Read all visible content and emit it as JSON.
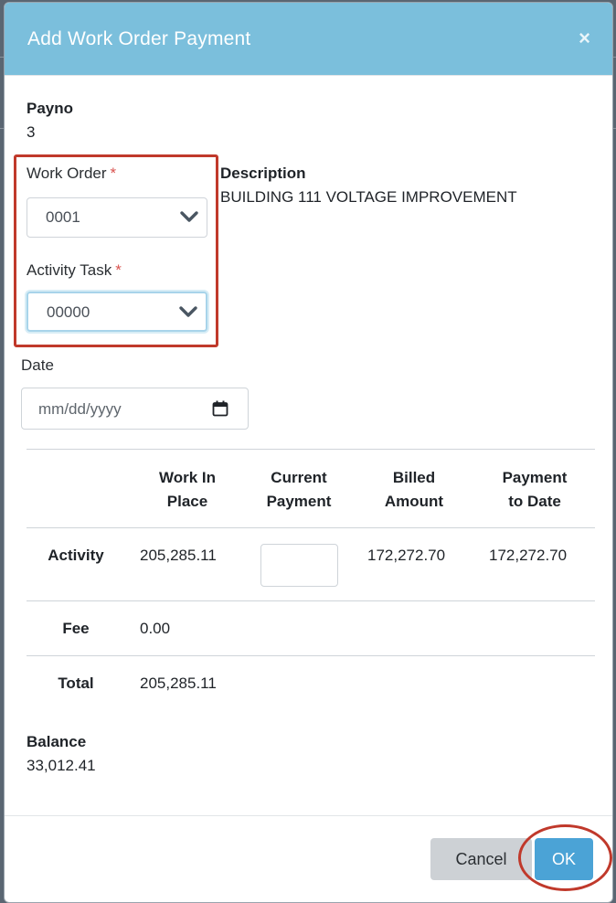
{
  "modal": {
    "title": "Add Work Order Payment",
    "close_icon": "close-icon"
  },
  "payno": {
    "label": "Payno",
    "value": "3"
  },
  "work_order": {
    "label": "Work Order",
    "required_mark": "*",
    "value": "0001"
  },
  "activity_task": {
    "label": "Activity Task",
    "required_mark": "*",
    "value": "00000"
  },
  "description": {
    "label": "Description",
    "value": "BUILDING 111 VOLTAGE IMPROVEMENT"
  },
  "date": {
    "label": "Date",
    "placeholder": "mm/dd/yyyy",
    "icon": "calendar-icon"
  },
  "table": {
    "headers": [
      [
        "Work In",
        "Place"
      ],
      [
        "Current",
        "Payment"
      ],
      [
        "Billed",
        "Amount"
      ],
      [
        "Payment",
        "to Date"
      ]
    ],
    "rows": [
      {
        "label": "Activity",
        "work_in_place": "205,285.11",
        "current_payment": "",
        "billed_amount": "172,272.70",
        "payment_to_date": "172,272.70"
      },
      {
        "label": "Fee",
        "work_in_place": "0.00"
      },
      {
        "label": "Total",
        "work_in_place": "205,285.11"
      }
    ]
  },
  "balance": {
    "label": "Balance",
    "value": "33,012.41"
  },
  "footer": {
    "cancel_label": "Cancel",
    "ok_label": "OK"
  },
  "colors": {
    "header": "#7bbfdc",
    "ok_button": "#4ba3d6",
    "highlight": "#c0392b",
    "required": "#d9534f"
  }
}
